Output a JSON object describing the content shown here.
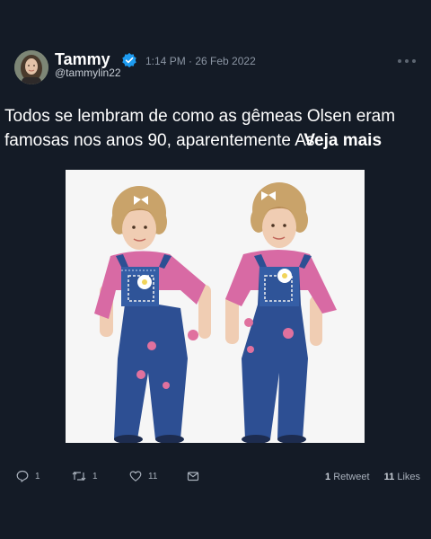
{
  "author": {
    "name": "Tammy",
    "handle": "@tammylin22",
    "verified": true,
    "timestamp": "1:14 PM · 26 Feb 2022"
  },
  "tweet": {
    "line1": "Todos se lembram de como as gêmeas Olsen eram",
    "line2": "famosas nos anos 90, aparentemente As",
    "see_more": "Veja mais",
    "image_description": "photo"
  },
  "actions": {
    "reply_count": "1",
    "retweet_count": "1",
    "like_count": "11"
  },
  "stats": {
    "retweets_num": "1",
    "retweets_label": "Retweet",
    "likes_num": "11",
    "likes_label": "Likes"
  },
  "colors": {
    "background": "#141b26",
    "verified": "#1d9bf0",
    "muted": "#8b95a3"
  }
}
